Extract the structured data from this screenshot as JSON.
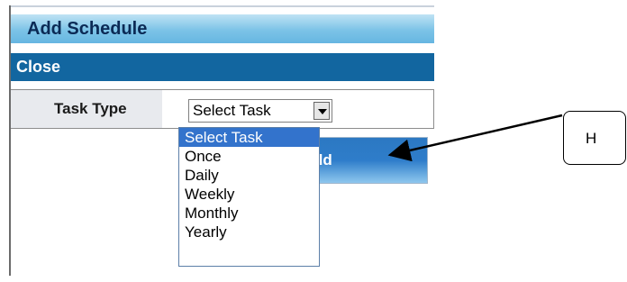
{
  "dialog": {
    "title": "Add Schedule",
    "close_label": "Close",
    "task_type_label": "Task Type",
    "add_button_visible_text": "dd"
  },
  "select": {
    "selected_value": "Select Task",
    "options": [
      "Select Task",
      "Once",
      "Daily",
      "Weekly",
      "Monthly",
      "Yearly"
    ],
    "highlighted_option": "Select Task"
  },
  "annotation": {
    "label": "H"
  },
  "colors": {
    "title_gradient_top": "#bfe3f4",
    "title_gradient_bottom": "#66b6e1",
    "close_bar": "#1266a0",
    "selected_option": "#3373cc"
  },
  "icons": {
    "select_arrow": "chevron-down-icon",
    "pointer": "arrow-icon"
  }
}
